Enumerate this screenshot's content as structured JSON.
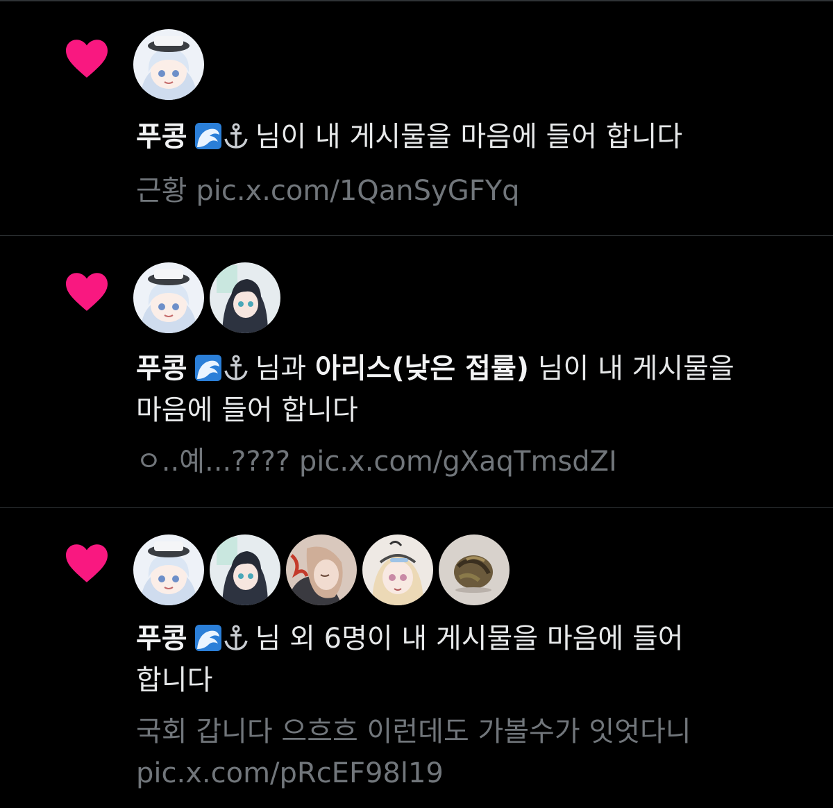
{
  "notifications": [
    {
      "actor_name": "푸콩",
      "actor_icons": [
        "water-wave-icon",
        "anchor-icon"
      ],
      "connector": "님이 내 게시물을 마음에 들어 합니다",
      "preview_text": "근황",
      "preview_link": "pic.x.com/1QanSyGFYq",
      "avatars": [
        "avatar-pukong"
      ]
    },
    {
      "actor_name": "푸콩",
      "actor_icons": [
        "water-wave-icon",
        "anchor-icon"
      ],
      "connector_and": "님과",
      "second_actor_name": "아리스(낮은 접률)",
      "connector": "님이 내 게시물을",
      "connector_line2": "마음에 들어 합니다",
      "preview_text": "ㅇ..예...????",
      "preview_link": "pic.x.com/gXaqTmsdZI",
      "avatars": [
        "avatar-pukong",
        "avatar-alice"
      ]
    },
    {
      "actor_name": "푸콩",
      "actor_icons": [
        "water-wave-icon",
        "anchor-icon"
      ],
      "connector": "님 외 6명이 내 게시물을 마음에 들어",
      "connector_line2": "합니다",
      "preview_text": "국회 갑니다 으흐흐 이런데도 가볼수가 잇엇다니",
      "preview_link": "pic.x.com/pRcEF98l19",
      "avatars": [
        "avatar-pukong",
        "avatar-alice",
        "avatar-3",
        "avatar-4",
        "avatar-5"
      ]
    }
  ],
  "colors": {
    "background": "#000000",
    "heart": "#f91880",
    "text": "#e7e9ea",
    "muted": "#71767b",
    "divider": "#2f3336"
  }
}
